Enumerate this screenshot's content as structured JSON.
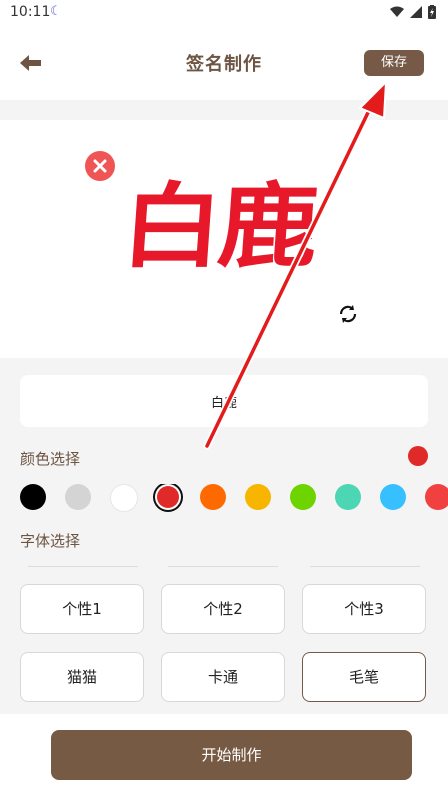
{
  "status": {
    "time": "10:11"
  },
  "header": {
    "title": "签名制作",
    "save_label": "保存"
  },
  "preview": {
    "signature_text": "白鹿"
  },
  "input": {
    "value": "白鹿",
    "placeholder": ""
  },
  "color_section": {
    "label": "颜色选择",
    "current_color": "#e02a2a",
    "swatches": [
      "#000000",
      "#d4d4d4",
      "#ffffff",
      "#e02a2a",
      "#ff6a00",
      "#f7b500",
      "#6dd400",
      "#4cd6b3",
      "#36c0ff",
      "#f04040"
    ],
    "selected_index": 3
  },
  "font_section": {
    "label": "字体选择",
    "options": [
      "个性1",
      "个性2",
      "个性3",
      "猫猫",
      "卡通",
      "毛笔"
    ],
    "selected_index": 5
  },
  "bottom": {
    "start_label": "开始制作"
  },
  "colors": {
    "accent": "#765a47",
    "signature": "#e8182b"
  }
}
